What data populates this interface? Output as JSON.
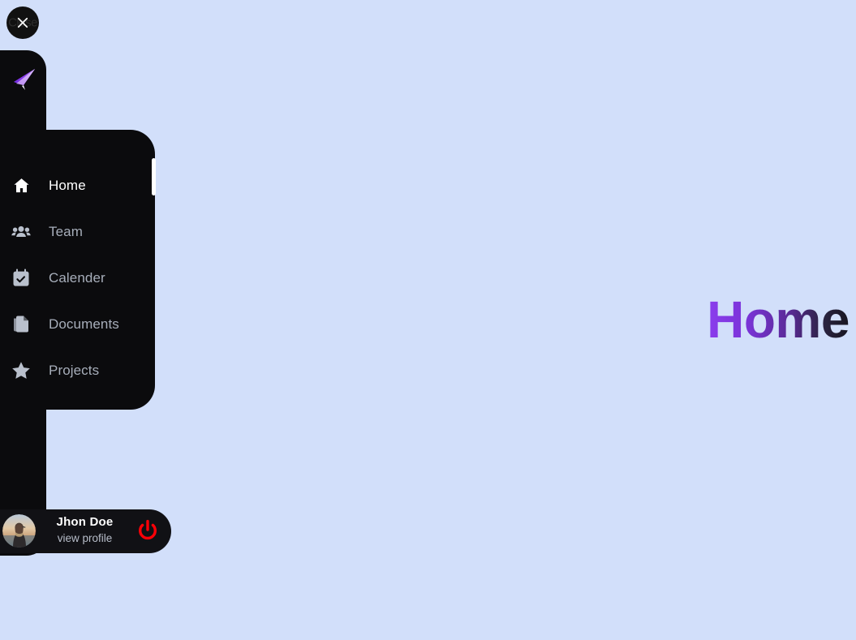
{
  "theme": {
    "background": "#d2dffa",
    "panel_background": "#0b0b0d",
    "accent_purple": "#8b3ded",
    "logout_red": "#fb0007",
    "active_text": "#ffffff",
    "inactive_text": "#a7aeba"
  },
  "close_button": {
    "icon": "close-x-icon",
    "ghost_label": "Close"
  },
  "logo": {
    "icon": "paper-plane-logo-icon"
  },
  "sidebar": {
    "items": [
      {
        "label": "Home",
        "icon": "home-icon",
        "active": true
      },
      {
        "label": "Team",
        "icon": "team-icon",
        "active": false
      },
      {
        "label": "Calender",
        "icon": "calendar-icon",
        "active": false
      },
      {
        "label": "Documents",
        "icon": "documents-icon",
        "active": false
      },
      {
        "label": "Projects",
        "icon": "star-icon",
        "active": false
      }
    ]
  },
  "profile": {
    "name": "Jhon Doe",
    "subtitle": "view profile",
    "avatar_icon": "user-avatar-photo",
    "logout_icon": "power-icon"
  },
  "main": {
    "title": "Home"
  }
}
